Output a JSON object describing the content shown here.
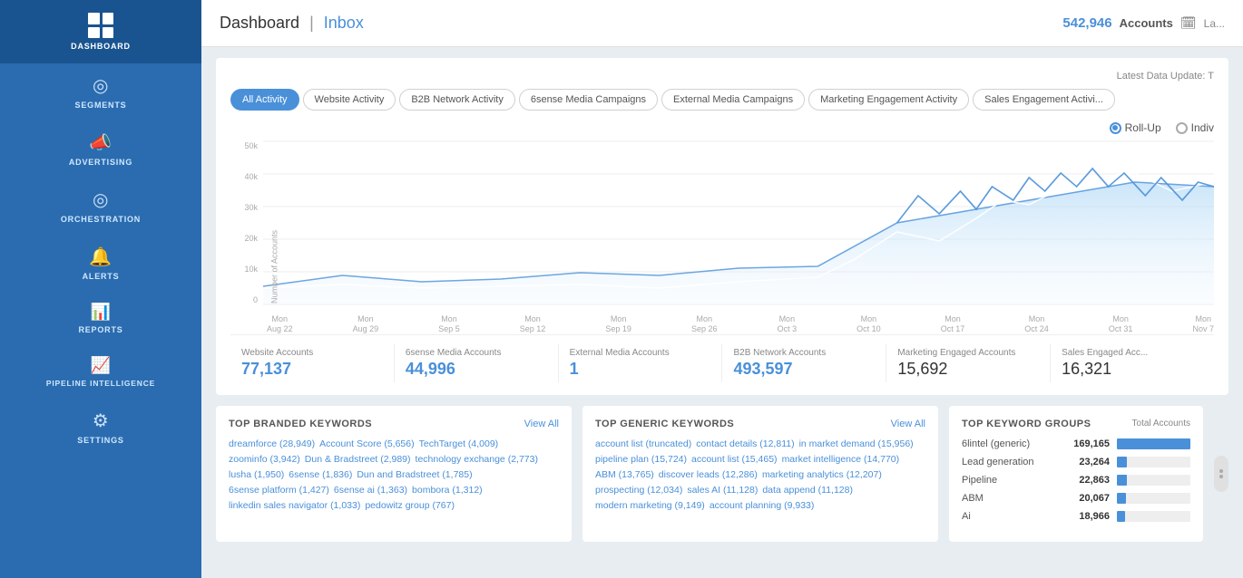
{
  "sidebar": {
    "items": [
      {
        "id": "dashboard",
        "label": "Dashboard",
        "icon": "grid"
      },
      {
        "id": "segments",
        "label": "Segments",
        "icon": "pie"
      },
      {
        "id": "advertising",
        "label": "Advertising",
        "icon": "megaphone"
      },
      {
        "id": "orchestration",
        "label": "Orchestration",
        "icon": "target"
      },
      {
        "id": "alerts",
        "label": "Alerts",
        "icon": "bell"
      },
      {
        "id": "reports",
        "label": "Reports",
        "icon": "chart"
      },
      {
        "id": "pipeline_intelligence",
        "label": "Pipeline Intelligence",
        "icon": "trend"
      },
      {
        "id": "settings",
        "label": "Settings",
        "icon": "gear"
      }
    ],
    "active": "dashboard"
  },
  "header": {
    "title": "Dashboard",
    "separator": "|",
    "inbox": "Inbox",
    "accounts_count": "542,946",
    "accounts_label": "Accounts",
    "calendar_icon": "🗓",
    "latest_data": "Latest Data Update: T"
  },
  "activity_tabs": [
    {
      "id": "all",
      "label": "All Activity",
      "active": true
    },
    {
      "id": "website",
      "label": "Website Activity"
    },
    {
      "id": "b2b_network",
      "label": "B2B Network Activity"
    },
    {
      "id": "6sense_media",
      "label": "6sense Media Campaigns"
    },
    {
      "id": "external_media",
      "label": "External Media Campaigns"
    },
    {
      "id": "marketing",
      "label": "Marketing Engagement Activity"
    },
    {
      "id": "sales",
      "label": "Sales Engagement Activi..."
    }
  ],
  "rollup": {
    "rollup_label": "Roll-Up",
    "individual_label": "Indiv",
    "rollup_active": true
  },
  "chart": {
    "y_label": "Number of Accounts",
    "y_ticks": [
      "50k",
      "40k",
      "30k",
      "20k",
      "10k",
      "0"
    ],
    "x_labels": [
      {
        "line1": "Mon",
        "line2": "Aug 22"
      },
      {
        "line1": "Mon",
        "line2": "Aug 29"
      },
      {
        "line1": "Mon",
        "line2": "Sep 5"
      },
      {
        "line1": "Mon",
        "line2": "Sep 12"
      },
      {
        "line1": "Mon",
        "line2": "Sep 19"
      },
      {
        "line1": "Mon",
        "line2": "Sep 26"
      },
      {
        "line1": "Mon",
        "line2": "Oct 3"
      },
      {
        "line1": "Mon",
        "line2": "Oct 10"
      },
      {
        "line1": "Mon",
        "line2": "Oct 17"
      },
      {
        "line1": "Mon",
        "line2": "Oct 24"
      },
      {
        "line1": "Mon",
        "line2": "Oct 31"
      },
      {
        "line1": "Mon",
        "line2": "Nov 7"
      }
    ]
  },
  "metrics": [
    {
      "label": "Website Accounts",
      "value": "77,137"
    },
    {
      "label": "6sense Media Accounts",
      "value": "44,996"
    },
    {
      "label": "External Media Accounts",
      "value": "1"
    },
    {
      "label": "B2B Network Accounts",
      "value": "493,597"
    },
    {
      "label": "Marketing Engaged Accounts",
      "value": "15,692"
    },
    {
      "label": "Sales Engaged Acc...",
      "value": "16,321"
    }
  ],
  "branded_keywords": {
    "title": "TOP BRANDED KEYWORDS",
    "view_all": "View All",
    "tags": [
      "dreamforce (28,949)",
      "Account Score (5,656)",
      "TechTarget (4,009)",
      "zoominfo (3,942)",
      "Dun & Bradstreet (2,989)",
      "technology exchange (2,773)",
      "lusha (1,950)",
      "6sense (1,836)",
      "Dun and Bradstreet (1,785)",
      "6sense platform (1,427)",
      "6sense ai (1,363)",
      "bombora (1,312)",
      "linkedin sales navigator (1,033)",
      "pedowitz group (767)"
    ]
  },
  "generic_keywords": {
    "title": "TOP GENERIC KEYWORDS",
    "view_all": "View All",
    "tags": [
      "account list (truncated)",
      "contact details (12,811)",
      "in market demand (15,956)",
      "pipeline plan (15,724)",
      "account list (15,465)",
      "market intelligence (14,770)",
      "ABM (13,765)",
      "discover leads (12,286)",
      "marketing analytics (12,207)",
      "prospecting (12,034)",
      "sales AI (11,128)",
      "data append (11,128)",
      "modern marketing (9,149)",
      "account planning (9,933)"
    ]
  },
  "keyword_groups": {
    "title": "TOP KEYWORD GROUPS",
    "total_label": "Total Accounts",
    "groups": [
      {
        "name": "6lintel (generic)",
        "count": "169,165",
        "pct": 100
      },
      {
        "name": "Lead generation",
        "count": "23,264",
        "pct": 14
      },
      {
        "name": "Pipeline",
        "count": "22,863",
        "pct": 13
      },
      {
        "name": "ABM",
        "count": "20,067",
        "pct": 12
      },
      {
        "name": "Ai",
        "count": "18,966",
        "pct": 11
      }
    ]
  }
}
